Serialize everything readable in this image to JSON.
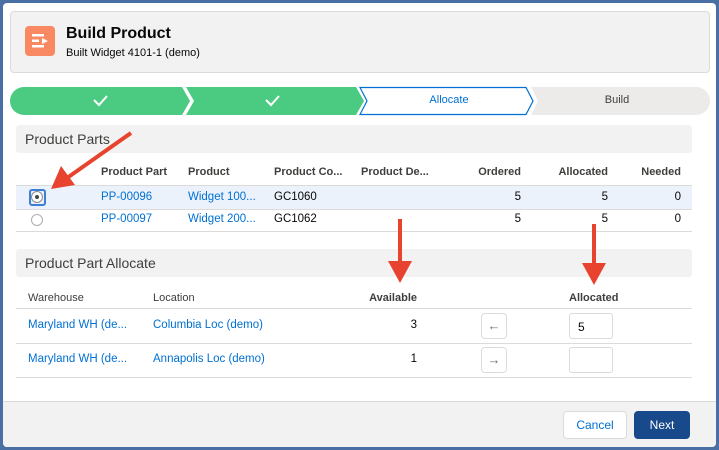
{
  "header": {
    "title": "Build Product",
    "subtitle": "Built Widget 4101-1 (demo)"
  },
  "path": {
    "steps": [
      {
        "label": "",
        "state": "complete"
      },
      {
        "label": "",
        "state": "complete"
      },
      {
        "label": "Allocate",
        "state": "current"
      },
      {
        "label": "Build",
        "state": "upcoming"
      }
    ]
  },
  "parts": {
    "section_title": "Product Parts",
    "columns": [
      "Product Part",
      "Product",
      "Product Co...",
      "Product De...",
      "Ordered",
      "Allocated",
      "Needed"
    ],
    "rows": [
      {
        "part": "PP-00096",
        "product": "Widget 100...",
        "code": "GC1060",
        "desc": "",
        "ordered": "5",
        "allocated": "5",
        "needed": "0",
        "selected": true
      },
      {
        "part": "PP-00097",
        "product": "Widget 200...",
        "code": "GC1062",
        "desc": "",
        "ordered": "5",
        "allocated": "5",
        "needed": "0",
        "selected": false
      }
    ]
  },
  "allocate": {
    "section_title": "Product Part Allocate",
    "columns": [
      "Warehouse",
      "Location",
      "Available",
      "Allocated"
    ],
    "rows": [
      {
        "warehouse": "Maryland WH (de...",
        "location": "Columbia Loc (demo)",
        "available": "3",
        "action": "←",
        "allocated": "5"
      },
      {
        "warehouse": "Maryland WH (de...",
        "location": "Annapolis Loc (demo)",
        "available": "1",
        "action": "→",
        "allocated": ""
      }
    ]
  },
  "footer": {
    "cancel_label": "Cancel",
    "next_label": "Next"
  },
  "colors": {
    "complete": "#4bca81",
    "brand": "#0070d2",
    "next_button": "#17498b",
    "annotation": "#e8432e"
  },
  "icons": {
    "header": "flow-icon",
    "step_complete": "check-icon",
    "annotation": "red-arrow"
  }
}
